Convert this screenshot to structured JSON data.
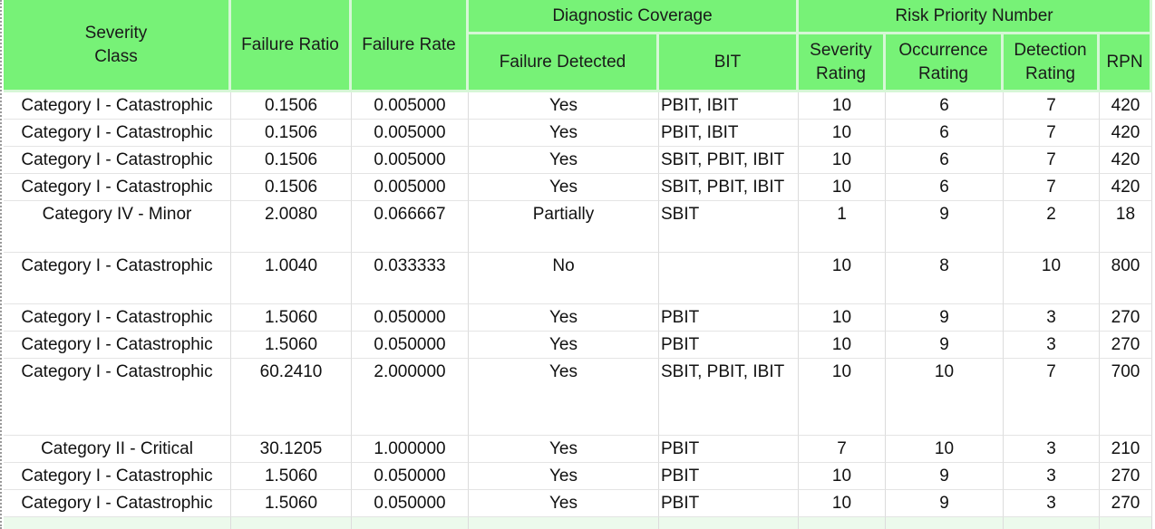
{
  "headers": {
    "severity_class": "Severity Class",
    "failure_ratio": "Failure Ratio",
    "failure_rate": "Failure Rate",
    "diagnostic_coverage": "Diagnostic Coverage",
    "failure_detected": "Failure Detected",
    "bit": "BIT",
    "risk_priority_number": "Risk Priority Number",
    "severity_rating": "Severity Rating",
    "occurrence_rating": "Occurrence Rating",
    "detection_rating": "Detection Rating",
    "rpn": "RPN"
  },
  "rows": [
    {
      "severity_class": "Category I - Catastrophic",
      "failure_ratio": "0.1506",
      "failure_rate": "0.005000",
      "failure_detected": "Yes",
      "bit": "PBIT, IBIT",
      "severity_rating": "10",
      "occurrence_rating": "6",
      "detection_rating": "7",
      "rpn": "420"
    },
    {
      "severity_class": "Category I - Catastrophic",
      "failure_ratio": "0.1506",
      "failure_rate": "0.005000",
      "failure_detected": "Yes",
      "bit": "PBIT, IBIT",
      "severity_rating": "10",
      "occurrence_rating": "6",
      "detection_rating": "7",
      "rpn": "420"
    },
    {
      "severity_class": "Category I - Catastrophic",
      "failure_ratio": "0.1506",
      "failure_rate": "0.005000",
      "failure_detected": "Yes",
      "bit": "SBIT, PBIT, IBIT",
      "severity_rating": "10",
      "occurrence_rating": "6",
      "detection_rating": "7",
      "rpn": "420"
    },
    {
      "severity_class": "Category I - Catastrophic",
      "failure_ratio": "0.1506",
      "failure_rate": "0.005000",
      "failure_detected": "Yes",
      "bit": "SBIT, PBIT, IBIT",
      "severity_rating": "10",
      "occurrence_rating": "6",
      "detection_rating": "7",
      "rpn": "420"
    },
    {
      "severity_class": "Category IV - Minor",
      "failure_ratio": "2.0080",
      "failure_rate": "0.066667",
      "failure_detected": "Partially",
      "bit": "SBIT",
      "severity_rating": "1",
      "occurrence_rating": "9",
      "detection_rating": "2",
      "rpn": "18"
    },
    {
      "severity_class": "Category I - Catastrophic",
      "failure_ratio": "1.0040",
      "failure_rate": "0.033333",
      "failure_detected": "No",
      "bit": "",
      "severity_rating": "10",
      "occurrence_rating": "8",
      "detection_rating": "10",
      "rpn": "800"
    },
    {
      "severity_class": "Category I - Catastrophic",
      "failure_ratio": "1.5060",
      "failure_rate": "0.050000",
      "failure_detected": "Yes",
      "bit": "PBIT",
      "severity_rating": "10",
      "occurrence_rating": "9",
      "detection_rating": "3",
      "rpn": "270"
    },
    {
      "severity_class": "Category I - Catastrophic",
      "failure_ratio": "1.5060",
      "failure_rate": "0.050000",
      "failure_detected": "Yes",
      "bit": "PBIT",
      "severity_rating": "10",
      "occurrence_rating": "9",
      "detection_rating": "3",
      "rpn": "270"
    },
    {
      "severity_class": "Category I - Catastrophic",
      "failure_ratio": "60.2410",
      "failure_rate": "2.000000",
      "failure_detected": "Yes",
      "bit": "SBIT, PBIT, IBIT",
      "severity_rating": "10",
      "occurrence_rating": "10",
      "detection_rating": "7",
      "rpn": "700"
    },
    {
      "severity_class": "Category II - Critical",
      "failure_ratio": "30.1205",
      "failure_rate": "1.000000",
      "failure_detected": "Yes",
      "bit": "PBIT",
      "severity_rating": "7",
      "occurrence_rating": "10",
      "detection_rating": "3",
      "rpn": "210"
    },
    {
      "severity_class": "Category I - Catastrophic",
      "failure_ratio": "1.5060",
      "failure_rate": "0.050000",
      "failure_detected": "Yes",
      "bit": "PBIT",
      "severity_rating": "10",
      "occurrence_rating": "9",
      "detection_rating": "3",
      "rpn": "270"
    },
    {
      "severity_class": "Category I - Catastrophic",
      "failure_ratio": "1.5060",
      "failure_rate": "0.050000",
      "failure_detected": "Yes",
      "bit": "PBIT",
      "severity_rating": "10",
      "occurrence_rating": "9",
      "detection_rating": "3",
      "rpn": "270"
    }
  ]
}
